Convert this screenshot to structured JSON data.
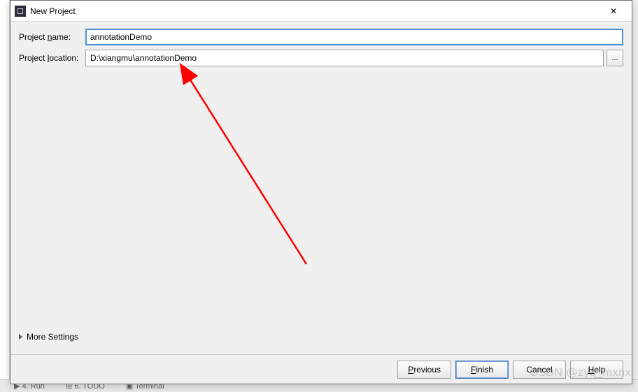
{
  "window": {
    "title": "New Project",
    "close_label": "✕"
  },
  "form": {
    "project_name_label_pre": "Project ",
    "project_name_label_u": "n",
    "project_name_label_post": "ame:",
    "project_name_value": "annotationDemo",
    "project_location_label_pre": "Project ",
    "project_location_label_u": "l",
    "project_location_label_post": "ocation:",
    "project_location_value": "D:\\xiangmu\\annotationDemo",
    "browse_label": "..."
  },
  "more_settings_label": "More Settings",
  "buttons": {
    "previous_pre": "",
    "previous_u": "P",
    "previous_post": "revious",
    "finish_pre": "",
    "finish_u": "F",
    "finish_post": "inish",
    "cancel": "Cancel",
    "help_pre": "",
    "help_u": "H",
    "help_post": "elp"
  },
  "bg": {
    "run": "▶ 4. Run",
    "todo": "⊞ 6. TODO",
    "terminal": "▣ Terminal"
  },
  "watermark": "CSDN @zyq_mxnx"
}
